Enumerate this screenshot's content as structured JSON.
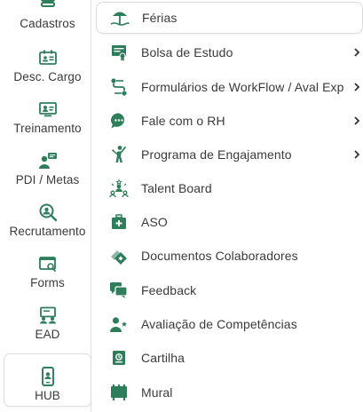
{
  "colors": {
    "accent": "#2e7d5b",
    "text": "#3a3a3a",
    "border": "#dcdcdc"
  },
  "sidebar": {
    "items": [
      {
        "label": "Cadastros",
        "icon": "stack-icon"
      },
      {
        "label": "Desc. Cargo",
        "icon": "id-card-icon"
      },
      {
        "label": "Treinamento",
        "icon": "presentation-icon"
      },
      {
        "label": "PDI / Metas",
        "icon": "person-chat-icon"
      },
      {
        "label": "Recrutamento",
        "icon": "search-person-icon"
      },
      {
        "label": "Forms",
        "icon": "form-icon"
      },
      {
        "label": "EAD",
        "icon": "classroom-icon"
      },
      {
        "label": "HUB",
        "icon": "mobile-hub-icon"
      }
    ]
  },
  "menu": {
    "items": [
      {
        "label": "Férias",
        "icon": "beach-icon",
        "has_submenu": false
      },
      {
        "label": "Bolsa de Estudo",
        "icon": "certificate-icon",
        "has_submenu": true
      },
      {
        "label": "Formulários de WorkFlow / Aval Exp",
        "icon": "workflow-icon",
        "has_submenu": true
      },
      {
        "label": "Fale com o RH",
        "icon": "chat-icon",
        "has_submenu": true
      },
      {
        "label": "Programa de Engajamento",
        "icon": "engagement-icon",
        "has_submenu": true
      },
      {
        "label": "Talent Board",
        "icon": "talent-icon",
        "has_submenu": false
      },
      {
        "label": "ASO",
        "icon": "medical-kit-icon",
        "has_submenu": false
      },
      {
        "label": "Documentos Colaboradores",
        "icon": "documents-icon",
        "has_submenu": false
      },
      {
        "label": "Feedback",
        "icon": "feedback-icon",
        "has_submenu": false
      },
      {
        "label": "Avaliação de Competências",
        "icon": "person-star-icon",
        "has_submenu": false
      },
      {
        "label": "Cartilha",
        "icon": "booklet-icon",
        "has_submenu": false
      },
      {
        "label": "Mural",
        "icon": "board-icon",
        "has_submenu": false
      }
    ]
  }
}
